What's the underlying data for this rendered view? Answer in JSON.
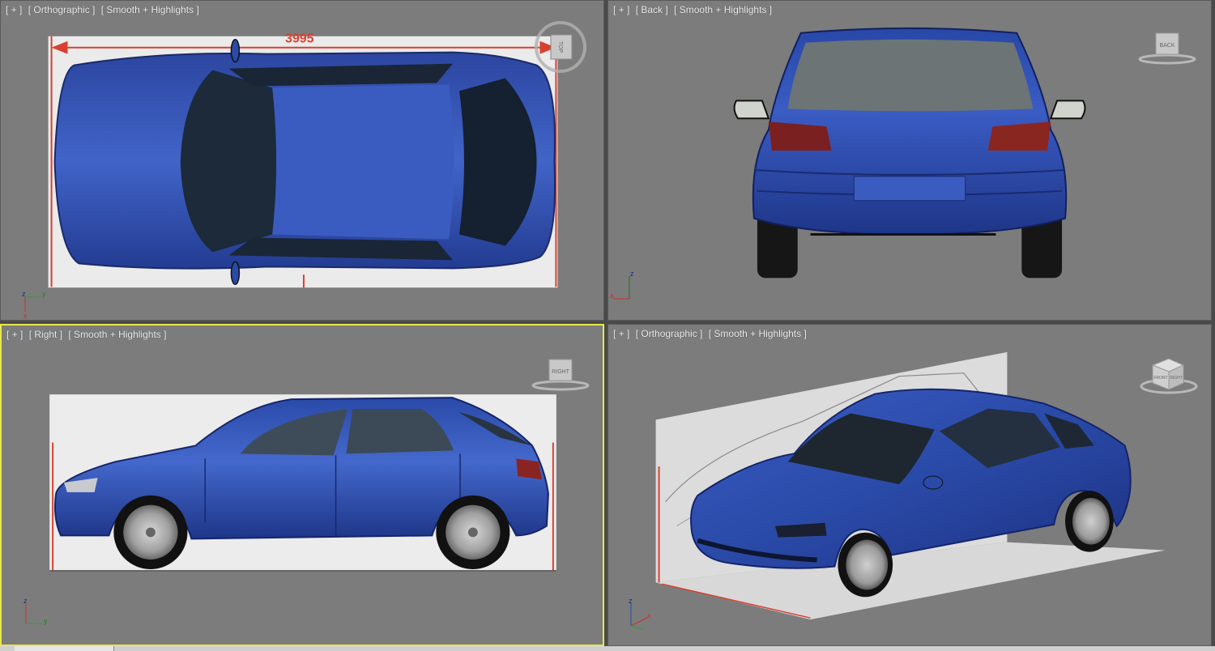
{
  "viewports": {
    "top_left": {
      "labels": [
        "[ + ]",
        "[ Orthographic ]",
        "[ Smooth + Highlights ]"
      ],
      "cube_label": "TOP",
      "dimension_text": "3995",
      "axis": {
        "a": "z",
        "b": "y",
        "c": "x"
      }
    },
    "top_right": {
      "labels": [
        "[ + ]",
        "[ Back ]",
        "[ Smooth + Highlights ]"
      ],
      "cube_label": "BACK",
      "axis": {
        "a": "z",
        "b": "x"
      }
    },
    "bottom_left": {
      "labels": [
        "[ + ]",
        "[ Right ]",
        "[ Smooth + Highlights ]"
      ],
      "cube_label": "RIGHT",
      "axis": {
        "a": "z",
        "b": "y"
      },
      "active": true
    },
    "bottom_right": {
      "labels": [
        "[ + ]",
        "[ Orthographic ]",
        "[ Smooth + Highlights ]"
      ],
      "cube_label_front": "FRONT",
      "cube_label_side": "RIGHT",
      "axis": {
        "a": "z",
        "b": "x"
      }
    }
  },
  "colors": {
    "viewport_bg": "#7c7c7c",
    "car_body": "#2a4aa8",
    "active_border": "#e8e84a"
  }
}
